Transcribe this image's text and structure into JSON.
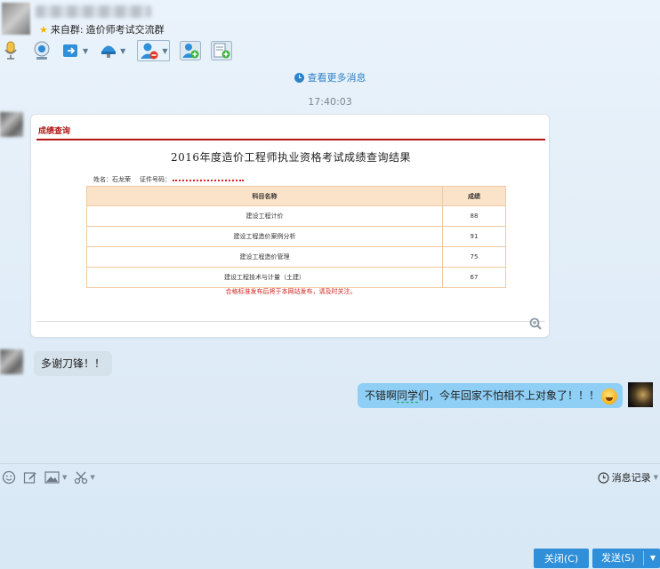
{
  "header": {
    "group_prefix": "来自群:",
    "group_name": "造价师考试交流群"
  },
  "chat": {
    "view_more": "查看更多消息",
    "timestamp": "17:40:03",
    "score_card": {
      "header": "成绩查询",
      "title": "2016年度造价工程师执业资格考试成绩查询结果",
      "name_label": "姓名：",
      "name_value": "石龙荣",
      "id_label": "证件号码：",
      "columns": [
        "科目名称",
        "成绩"
      ],
      "rows": [
        {
          "subject": "建设工程计价",
          "score": "88"
        },
        {
          "subject": "建设工程造价案例分析",
          "score": "91"
        },
        {
          "subject": "建设工程造价管理",
          "score": "75"
        },
        {
          "subject": "建设工程技术与计量（土建）",
          "score": "67"
        }
      ],
      "note": "合格标准发布后将于本网站发布，请及时关注。"
    },
    "msg1_text": "多谢刀锋！！",
    "msg2_text_a": "不错啊",
    "msg2_text_b": "同学",
    "msg2_text_c": "们，今年回家不怕相不上对象了！！！"
  },
  "input_area": {
    "history_label": "消息记录"
  },
  "buttons": {
    "close_label": "关闭(C)",
    "send_label": "发送(S)"
  },
  "colors": {
    "accent": "#2f8fd8",
    "link": "#2f82c6",
    "self_bubble": "#8fcff6",
    "other_bubble": "#d5e1eb",
    "score_red": "#b31515"
  }
}
